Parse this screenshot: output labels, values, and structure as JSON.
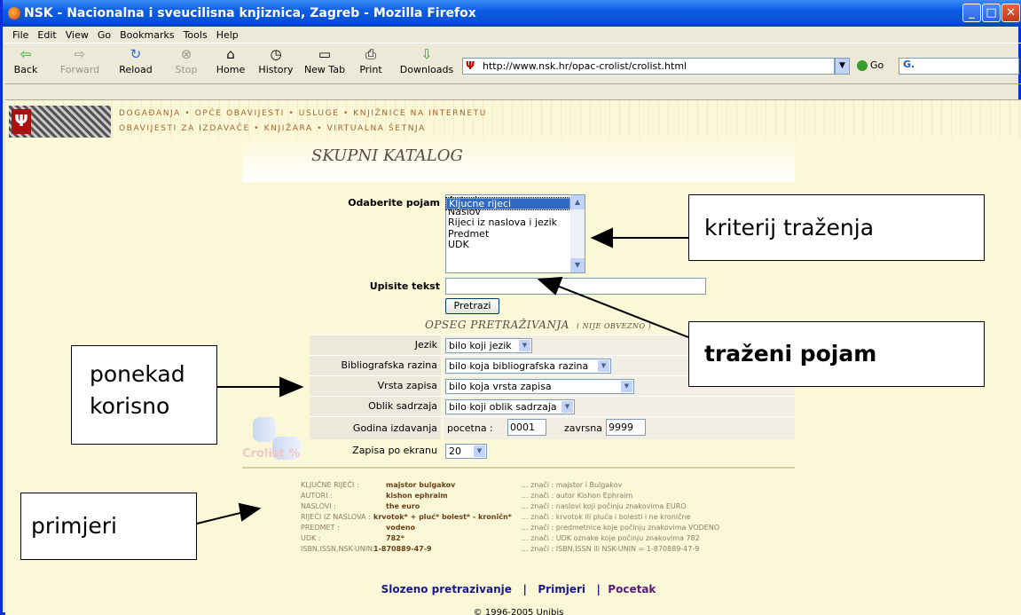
{
  "window": {
    "title": "NSK - Nacionalna i sveucilisna knjiznica, Zagreb - Mozilla Firefox"
  },
  "menu": [
    "File",
    "Edit",
    "View",
    "Go",
    "Bookmarks",
    "Tools",
    "Help"
  ],
  "toolbar": {
    "back": "Back",
    "forward": "Forward",
    "reload": "Reload",
    "stop": "Stop",
    "home": "Home",
    "history": "History",
    "new_tab": "New Tab",
    "print": "Print",
    "downloads": "Downloads",
    "url": "http://www.nsk.hr/opac-crolist/crolist.html",
    "go": "Go",
    "google": "G."
  },
  "site_nav": {
    "line1": "DOGAĐANJA • OPĆE OBAVIJESTI • USLUGE • KNJIŽNICE NA INTERNETU",
    "line2": "OBAVIJESTI ZA IZDAVAČE • KNJIŽARA • VIRTUALNA ŠETNJA"
  },
  "catalog": {
    "title": "SKUPNI KATALOG",
    "term_label": "Odaberite pojam",
    "term_options": [
      "Kljucne rijeci",
      "Autori",
      "Naslov",
      "Rijeci iz naslova i jezik",
      "Predmet",
      "UDK"
    ],
    "text_label": "Upisite tekst",
    "search_button": "Pretrazi",
    "scope_title": "OPSEG PRETRAŽIVANJA",
    "scope_note": "( NIJE OBVEZNO )",
    "filters": {
      "jezik_label": "Jezik",
      "jezik_value": "bilo koji jezik",
      "razina_label": "Bibliografska razina",
      "razina_value": "bilo koja bibliografska razina",
      "vrsta_label": "Vrsta zapisa",
      "vrsta_value": "bilo koja vrsta zapisa",
      "oblik_label": "Oblik sadrzaja",
      "oblik_value": "bilo koji oblik sadrzaja",
      "godina_label": "Godina izdavanja",
      "pocetna_label": "pocetna :",
      "pocetna_value": "0001",
      "zavrsna_label": "zavrsna :",
      "zavrsna_value": "9999",
      "zapisa_label": "Zapisa po ekranu",
      "zapisa_value": "20"
    },
    "crolist_logo": "Crolist %"
  },
  "examples": [
    {
      "k": "KLJUČNE RIJEČI :",
      "v": "majstor bulgakov",
      "m": "... znači : majstor i Bulgakov"
    },
    {
      "k": "AUTORI :",
      "v": "kishon ephraim",
      "m": "... znači : autor Kishon Ephraim"
    },
    {
      "k": "NASLOVI :",
      "v": "the euro",
      "m": "... znači : naslovi koji počinju znakovima EURO"
    },
    {
      "k": "RIJEČI IZ NASLOVA :",
      "v": "krvotok* + pluć* bolest* - kroničn*",
      "m": "... znači : krvotok ili pluća i bolesti i ne kronične"
    },
    {
      "k": "PREDMET :",
      "v": "vodeno",
      "m": "... znači : predmetnice koje počinju znakovima VODENO"
    },
    {
      "k": "UDK :",
      "v": "782*",
      "m": "... znači : UDK oznake koje počinju znakovima 782"
    },
    {
      "k": "ISBN,ISSN,NSK-UNIN:",
      "v": "1-870889-47-9",
      "m": "... znači : ISBN,ISSN ili NSK-UNIN = 1-870889-47-9"
    }
  ],
  "footer": {
    "links": [
      "Slozeno pretrazivanje",
      "Primjeri",
      "Pocetak"
    ],
    "sep": "|",
    "copyright": "© 1996-2005 Unibis"
  },
  "callouts": {
    "kriterij": "kriterij traženja",
    "trazeni": "traženi pojam",
    "ponekad": "ponekad korisno",
    "primjeri": "primjeri"
  }
}
